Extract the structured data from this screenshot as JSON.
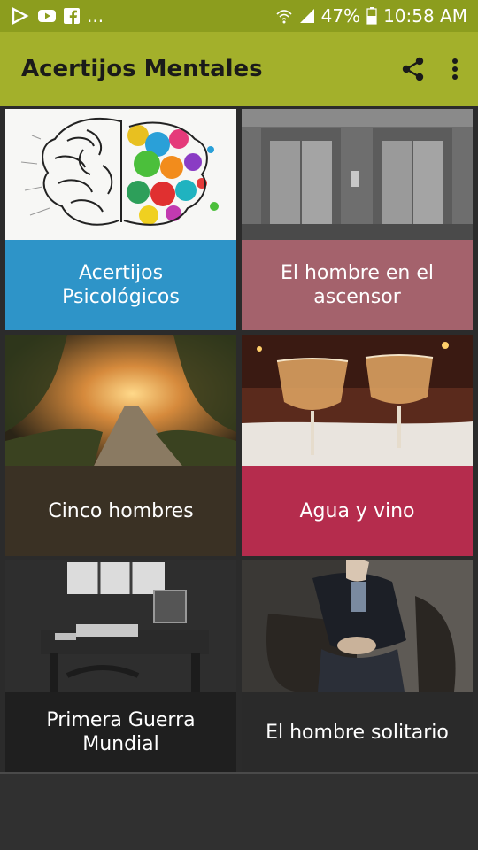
{
  "status_bar": {
    "notif_more": "...",
    "battery_percent": "47%",
    "time": "10:58 AM"
  },
  "toolbar": {
    "title": "Acertijos Mentales",
    "share_icon": "share-icon",
    "menu_icon": "overflow-menu-icon"
  },
  "colors": {
    "status_bar": "#8c9d1e",
    "toolbar": "#a3b02b",
    "card_blue": "#2e94c8",
    "card_rose": "#a4626c",
    "card_dark_brown": "#3a3124",
    "card_crimson": "#b52c4d",
    "card_black": "#1f1f1f",
    "card_charcoal": "#2a2a2a"
  },
  "cards": [
    {
      "title": "Acertijos Psicológicos",
      "image": "brain-illustration"
    },
    {
      "title": "El hombre en el ascensor",
      "image": "elevator-doors"
    },
    {
      "title": "Cinco hombres",
      "image": "forest-path"
    },
    {
      "title": "Agua y vino",
      "image": "wine-glasses"
    },
    {
      "title": "Primera Guerra Mundial",
      "image": "old-desk-room"
    },
    {
      "title": "El hombre solitario",
      "image": "man-in-armchair"
    }
  ]
}
